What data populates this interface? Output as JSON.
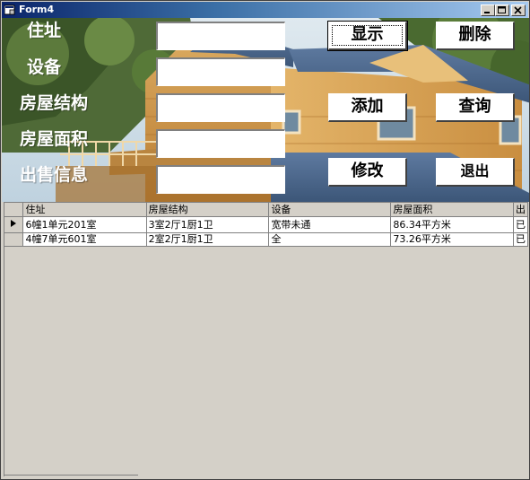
{
  "window": {
    "title": "Form4"
  },
  "labels": {
    "address": "住址",
    "equipment": "设备",
    "structure": "房屋结构",
    "area": "房屋面积",
    "sale_info": "出售信息"
  },
  "inputs": {
    "address": "",
    "equipment": "",
    "structure": "",
    "area": "",
    "sale_info": ""
  },
  "buttons": {
    "show": "显示",
    "delete": "删除",
    "add": "添加",
    "query": "查询",
    "modify": "修改",
    "exit": "退出"
  },
  "grid": {
    "columns": [
      "住址",
      "房屋结构",
      "设备",
      "房屋面积",
      "出"
    ],
    "rows": [
      [
        "6幢1单元201室",
        "3室2厅1厨1卫",
        "宽带未通",
        "86.34平方米",
        "已"
      ],
      [
        "4幢7单元601室",
        "2室2厅1厨1卫",
        "全",
        "73.26平方米",
        "已"
      ]
    ]
  }
}
